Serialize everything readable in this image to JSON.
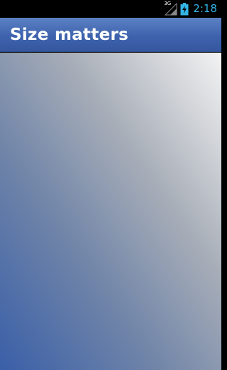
{
  "status_bar": {
    "network_type": "3G",
    "time": "2:18",
    "icons": [
      "signal-icon",
      "battery-charging-icon"
    ],
    "clock_color": "#33b5e5"
  },
  "action_bar": {
    "title": "Size matters",
    "color": "#3e63ad"
  },
  "content": {
    "gradient_colors": [
      "#f3f3f3",
      "#3a5fa8"
    ]
  }
}
